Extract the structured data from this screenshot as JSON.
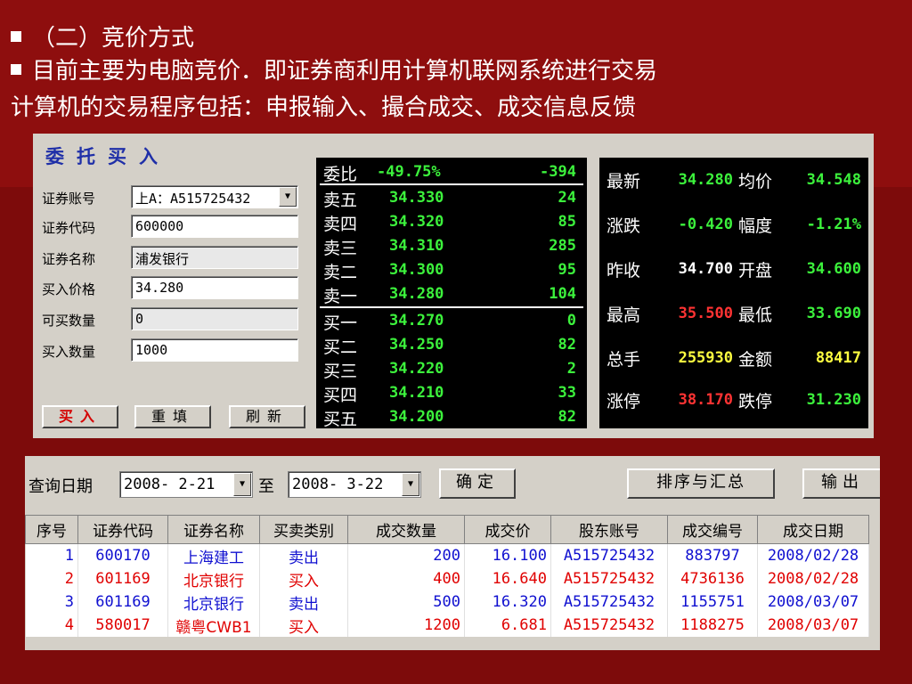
{
  "slide": {
    "line1": "（二）竞价方式",
    "line2": "目前主要为电脑竞价．即证券商利用计算机联网系统进行交易",
    "line3": "计算机的交易程序包括：申报输入、撮合成交、成交信息反馈"
  },
  "order": {
    "title": "委托买入",
    "fields": [
      {
        "label": "证券账号",
        "value": "上A：A515725432"
      },
      {
        "label": "证券代码",
        "value": "600000"
      },
      {
        "label": "证券名称",
        "value": "浦发银行"
      },
      {
        "label": "买入价格",
        "value": "34.280"
      },
      {
        "label": "可买数量",
        "value": "0"
      },
      {
        "label": "买入数量",
        "value": "1000"
      }
    ],
    "buttons": {
      "buy": "买入",
      "reset": "重填",
      "refresh": "刷新"
    }
  },
  "quote": {
    "ratio": {
      "label": "委比",
      "value": "-49.75%",
      "diff": "-394"
    },
    "sells": [
      {
        "label": "卖五",
        "price": "34.330",
        "vol": "24"
      },
      {
        "label": "卖四",
        "price": "34.320",
        "vol": "85"
      },
      {
        "label": "卖三",
        "price": "34.310",
        "vol": "285"
      },
      {
        "label": "卖二",
        "price": "34.300",
        "vol": "95"
      },
      {
        "label": "卖一",
        "price": "34.280",
        "vol": "104"
      }
    ],
    "buys": [
      {
        "label": "买一",
        "price": "34.270",
        "vol": "0"
      },
      {
        "label": "买二",
        "price": "34.250",
        "vol": "82"
      },
      {
        "label": "买三",
        "price": "34.220",
        "vol": "2"
      },
      {
        "label": "买四",
        "price": "34.210",
        "vol": "33"
      },
      {
        "label": "买五",
        "price": "34.200",
        "vol": "82"
      }
    ]
  },
  "stats": {
    "rows": [
      {
        "l1": "最新",
        "v1": "34.280",
        "l2": "均价",
        "v2": "34.548"
      },
      {
        "l1": "涨跌",
        "v1": "-0.420",
        "l2": "幅度",
        "v2": "-1.21%"
      },
      {
        "l1": "昨收",
        "v1": "34.700",
        "l2": "开盘",
        "v2": "34.600"
      },
      {
        "l1": "最高",
        "v1": "35.500",
        "l2": "最低",
        "v2": "33.690"
      },
      {
        "l1": "总手",
        "v1": "255930",
        "l2": "金额",
        "v2": "88417"
      },
      {
        "l1": "涨停",
        "v1": "38.170",
        "l2": "跌停",
        "v2": "31.230"
      }
    ],
    "colors": {
      "green": "#3cf23c",
      "white": "#ffffff",
      "red": "#ff3333",
      "yellow": "#ffff40"
    }
  },
  "query": {
    "date_label": "查询日期",
    "from_date": "2008- 2-21",
    "to_label": "至",
    "to_date": "2008- 3-22",
    "confirm": "确定",
    "sort": "排序与汇总",
    "export": "输出",
    "headers": [
      "序号",
      "证券代码",
      "证券名称",
      "买卖类别",
      "成交数量",
      "成交价",
      "股东账号",
      "成交编号",
      "成交日期"
    ],
    "rows": [
      {
        "no": "1",
        "code": "600170",
        "name": "上海建工",
        "side": "卖出",
        "qty": "200",
        "price": "16.100",
        "acct": "A515725432",
        "deal": "883797",
        "date": "2008/02/28",
        "color": "blue"
      },
      {
        "no": "2",
        "code": "601169",
        "name": "北京银行",
        "side": "买入",
        "qty": "400",
        "price": "16.640",
        "acct": "A515725432",
        "deal": "4736136",
        "date": "2008/02/28",
        "color": "red"
      },
      {
        "no": "3",
        "code": "601169",
        "name": "北京银行",
        "side": "卖出",
        "qty": "500",
        "price": "16.320",
        "acct": "A515725432",
        "deal": "1155751",
        "date": "2008/03/07",
        "color": "blue"
      },
      {
        "no": "4",
        "code": "580017",
        "name": "赣粤CWB1",
        "side": "买入",
        "qty": "1200",
        "price": "6.681",
        "acct": "A515725432",
        "deal": "1188275",
        "date": "2008/03/07",
        "color": "red"
      }
    ]
  }
}
